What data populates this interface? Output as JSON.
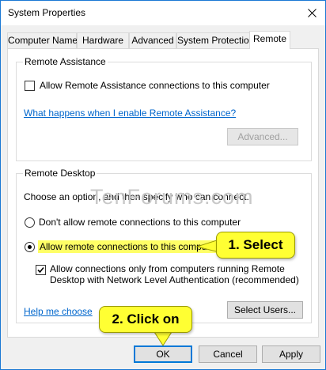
{
  "window": {
    "title": "System Properties"
  },
  "tabs": [
    {
      "label": "Computer Name",
      "active": false
    },
    {
      "label": "Hardware",
      "active": false
    },
    {
      "label": "Advanced",
      "active": false
    },
    {
      "label": "System Protection",
      "active": false
    },
    {
      "label": "Remote",
      "active": true
    }
  ],
  "remote_assistance": {
    "group_title": "Remote Assistance",
    "allow_checkbox_label": "Allow Remote Assistance connections to this computer",
    "allow_checked": false,
    "help_link": "What happens when I enable Remote Assistance?",
    "advanced_button": "Advanced..."
  },
  "watermark": "TenForums.com",
  "remote_desktop": {
    "group_title": "Remote Desktop",
    "instructions": "Choose an option, and then specify who can connect.",
    "option_dont_allow": "Don't allow remote connections to this computer",
    "option_allow": "Allow remote connections to this computer",
    "selected_option": "allow",
    "nla_label_line1": "Allow connections only from computers running Remote",
    "nla_label_line2": "Desktop with Network Level Authentication (recommended)",
    "nla_checked": true,
    "help_link": "Help me choose",
    "select_users_button": "Select Users..."
  },
  "callouts": {
    "step1": "1. Select",
    "step2": "2. Click on"
  },
  "footer": {
    "ok": "OK",
    "cancel": "Cancel",
    "apply": "Apply"
  },
  "colors": {
    "link": "#0066cc",
    "callout": "#ffff33",
    "highlight": "#ffff66",
    "focus_border": "#0078d7"
  }
}
